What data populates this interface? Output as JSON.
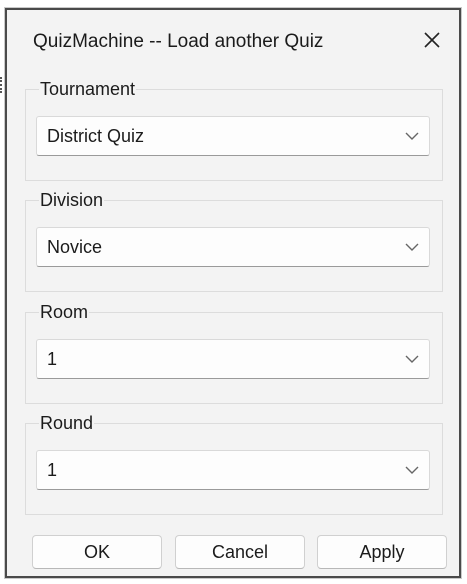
{
  "window": {
    "title": "QuizMachine -- Load another Quiz"
  },
  "fields": [
    {
      "label": "Tournament",
      "value": "District Quiz"
    },
    {
      "label": "Division",
      "value": "Novice"
    },
    {
      "label": "Room",
      "value": "1"
    },
    {
      "label": "Round",
      "value": "1"
    }
  ],
  "buttons": {
    "ok": "OK",
    "cancel": "Cancel",
    "apply": "Apply"
  },
  "icons": {
    "close": "close-icon",
    "dropdown": "chevron-down-icon"
  }
}
